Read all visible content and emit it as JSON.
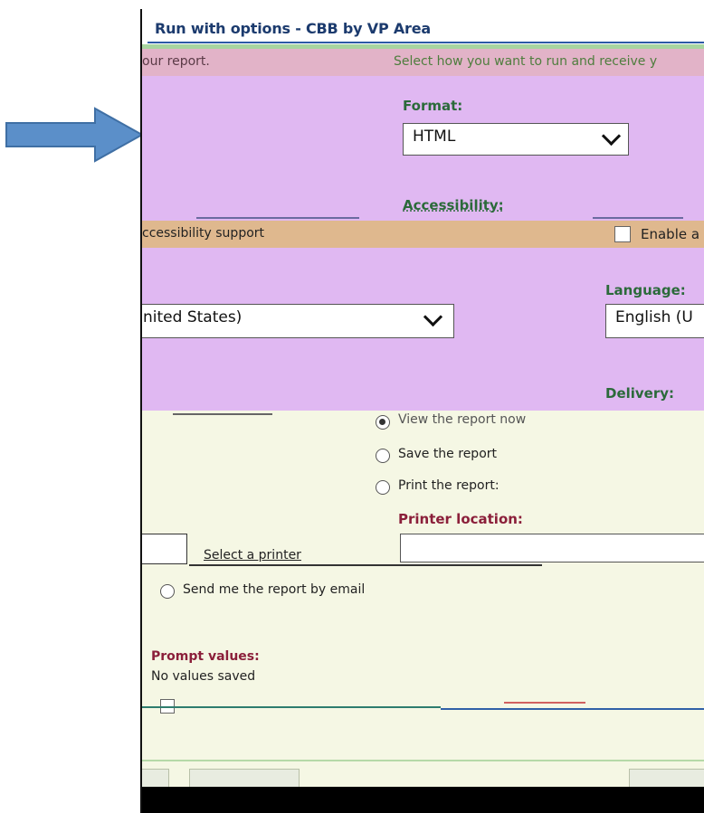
{
  "dialog": {
    "title": "Run with options - CBB by VP Area",
    "intro_left": "our report.",
    "intro_right": "Select how you want to run and receive y"
  },
  "format": {
    "label": "Format:",
    "value": "HTML"
  },
  "accessibility": {
    "label": "Accessibility:",
    "left_text": "ccessibility support",
    "checkbox_label": "Enable a"
  },
  "language": {
    "label": "Language:",
    "left_value": "nited States)",
    "value": "English (U"
  },
  "delivery": {
    "label": "Delivery:",
    "options": [
      {
        "label": "View the report now",
        "selected": true
      },
      {
        "label": "Save the report",
        "selected": false
      },
      {
        "label": "Print the report:",
        "selected": false
      }
    ],
    "printer_location_label": "Printer location:",
    "select_printer_label": "Select a printer",
    "email_option": "Send me the report by email"
  },
  "prompts": {
    "label": "Prompt values:",
    "value": "No values saved"
  },
  "colors": {
    "purple": "#e0b8f2",
    "orange": "#dfb88e",
    "pink": "#e2b3c8",
    "cream": "#f5f7e4",
    "arrow": "#5b8fc9"
  }
}
